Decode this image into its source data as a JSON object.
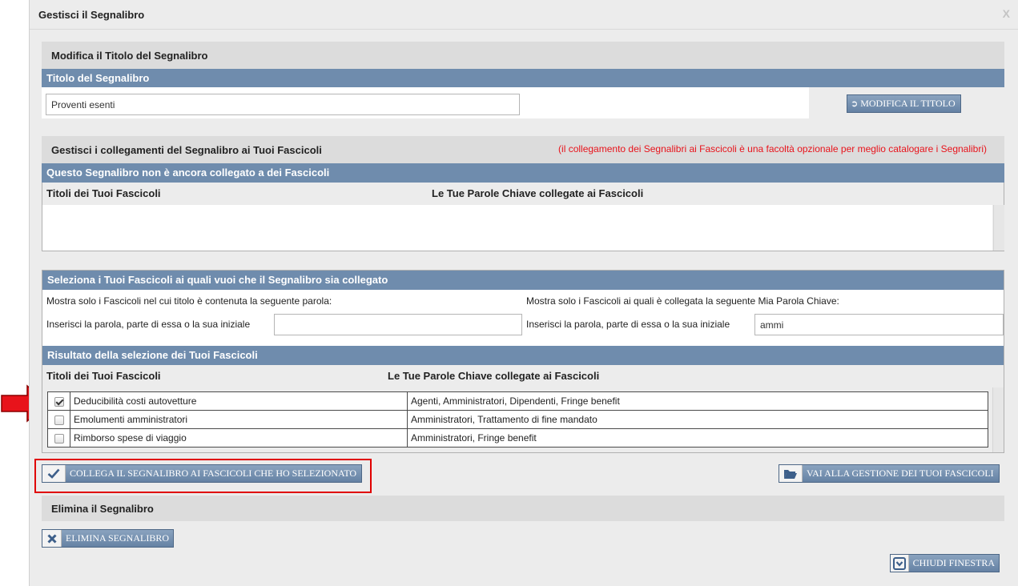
{
  "dialog": {
    "title": "Gestisci il Segnalibro",
    "close_label": "X"
  },
  "edit_title": {
    "heading": "Modifica il Titolo del Segnalibro",
    "bar": "Titolo del Segnalibro",
    "input_value": "Proventi esenti",
    "button": "MODIFICA IL TITOLO"
  },
  "links": {
    "heading": "Gestisci i collegamenti del Segnalibro ai Tuoi Fascicoli",
    "note": "(il collegamento dei Segnalibri ai Fascicoli è una facoltà opzionale per meglio catalogare i Segnalibri)",
    "bar": "Questo Segnalibro non è ancora collegato a dei Fascicoli",
    "col_titles": "Titoli dei Tuoi Fascicoli",
    "col_keywords": "Le Tue Parole Chiave collegate ai Fascicoli"
  },
  "select": {
    "bar": "Seleziona i Tuoi Fascicoli ai quali vuoi che il Segnalibro sia collegato",
    "filter_title_desc": "Mostra solo i Fascicoli nel cui titolo è contenuta la seguente parola:",
    "filter_keyword_desc": "Mostra solo i Fascicoli ai quali è collegata la seguente Mia Parola Chiave:",
    "input_label_left": "Inserisci la parola, parte di essa o la sua iniziale",
    "input_label_right": "Inserisci la parola, parte di essa o la sua iniziale",
    "title_filter_value": "",
    "keyword_filter_value": "ammi"
  },
  "results": {
    "bar": "Risultato della selezione dei Tuoi Fascicoli",
    "col_titles": "Titoli dei Tuoi Fascicoli",
    "col_keywords": "Le Tue Parole Chiave collegate ai Fascicoli",
    "rows": [
      {
        "checked": true,
        "title": "Deducibilità costi autovetture",
        "keywords": "Agenti, Amministratori, Dipendenti, Fringe benefit"
      },
      {
        "checked": false,
        "title": "Emolumenti amministratori",
        "keywords": "Amministratori, Trattamento di fine mandato"
      },
      {
        "checked": false,
        "title": "Rimborso spese di viaggio",
        "keywords": "Amministratori, Fringe benefit"
      }
    ]
  },
  "actions": {
    "link_button": "COLLEGA IL SEGNALIBRO AI FASCICOLI CHE HO SELEZIONATO",
    "manage_button": "VAI ALLA GESTIONE DEI TUOI FASCICOLI"
  },
  "delete": {
    "heading": "Elimina il Segnalibro",
    "button": "ELIMINA SEGNALIBRO"
  },
  "close_button": "CHIUDI FINESTRA",
  "colors": {
    "bar_blue": "#6f8cad",
    "note_red": "#e8131b",
    "arrow_red": "#e8131b",
    "highlight_border": "#e00000"
  }
}
